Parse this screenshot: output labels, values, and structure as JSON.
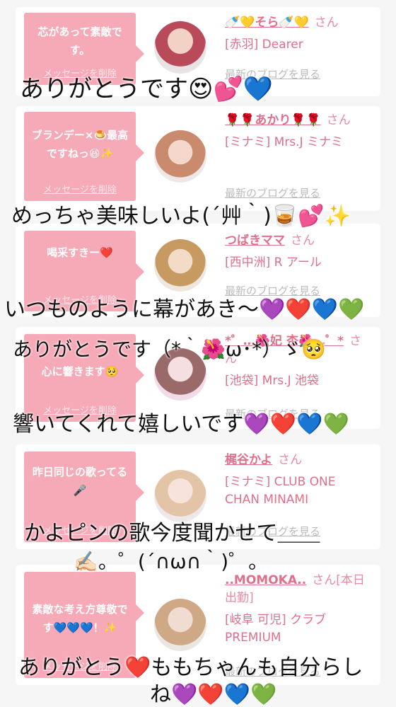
{
  "cards": [
    {
      "message": "芯があって素敵です。",
      "delete_label": "メッセージを削除",
      "name": "🍼💛そら🍼💛",
      "honorific": "さん",
      "shop": "[赤羽] Dearer",
      "blog_label": "最新のブログを見る"
    },
    {
      "message": "ブランデー×🍮最高ですねっ😆✨",
      "delete_label": "メッセージを削除",
      "name": "🌹🌹あかり🌹🌹",
      "honorific": "さん",
      "shop": "[ミナミ] Mrs.J ミナミ",
      "blog_label": "最新のブログを見る"
    },
    {
      "message": "喝采すきー❤️",
      "delete_label": "メッセージを削除",
      "name": "つばきママ",
      "honorific": "さん",
      "shop": "[西中洲] R アール",
      "blog_label": "最新のブログを見る"
    },
    {
      "message": "心に響きます🥺",
      "delete_label": "メッセージを削除",
      "name": "*゜…🌺妃 杏🌺…゜*",
      "honorific": "さん",
      "shop": "[池袋] Mrs.J 池袋",
      "blog_label": "最新のブログを見る"
    },
    {
      "message": "昨日同じの歌ってる🎤",
      "delete_label": "メッセージを削除",
      "name": "梶谷かよ",
      "honorific": "さん",
      "shop": "[ミナミ] CLUB ONE CHAN MINAMI",
      "blog_label": "最新のブログを見る"
    },
    {
      "message": "素敵な考え方尊敬です💙💙💙！✨",
      "delete_label": "メッセージを削除",
      "name": "..MOMOKA..",
      "honorific": "さん[本日出勤]",
      "shop": "[岐阜 可児] クラブPREMIUM",
      "blog_label": "最新のブログを見る"
    }
  ],
  "captions": [
    "ありがとうです😍💕💙",
    "めっちゃ美味しいよ(´艸｀)🥃💕✨",
    "いつものように幕があき〜💜❤️💙💚",
    "ありがとうです（*｀🌺ω･*）ゞ🥺",
    "響いてくれて嬉しいです💜❤️💙💚",
    "かよピンの歌今度聞かせて＿＿",
    "✍🏻。゜(´∩ω∩｀)゜。",
    "ありがとう❤️ももちゃんも自分らし",
    "ね💜❤️💙💚"
  ]
}
